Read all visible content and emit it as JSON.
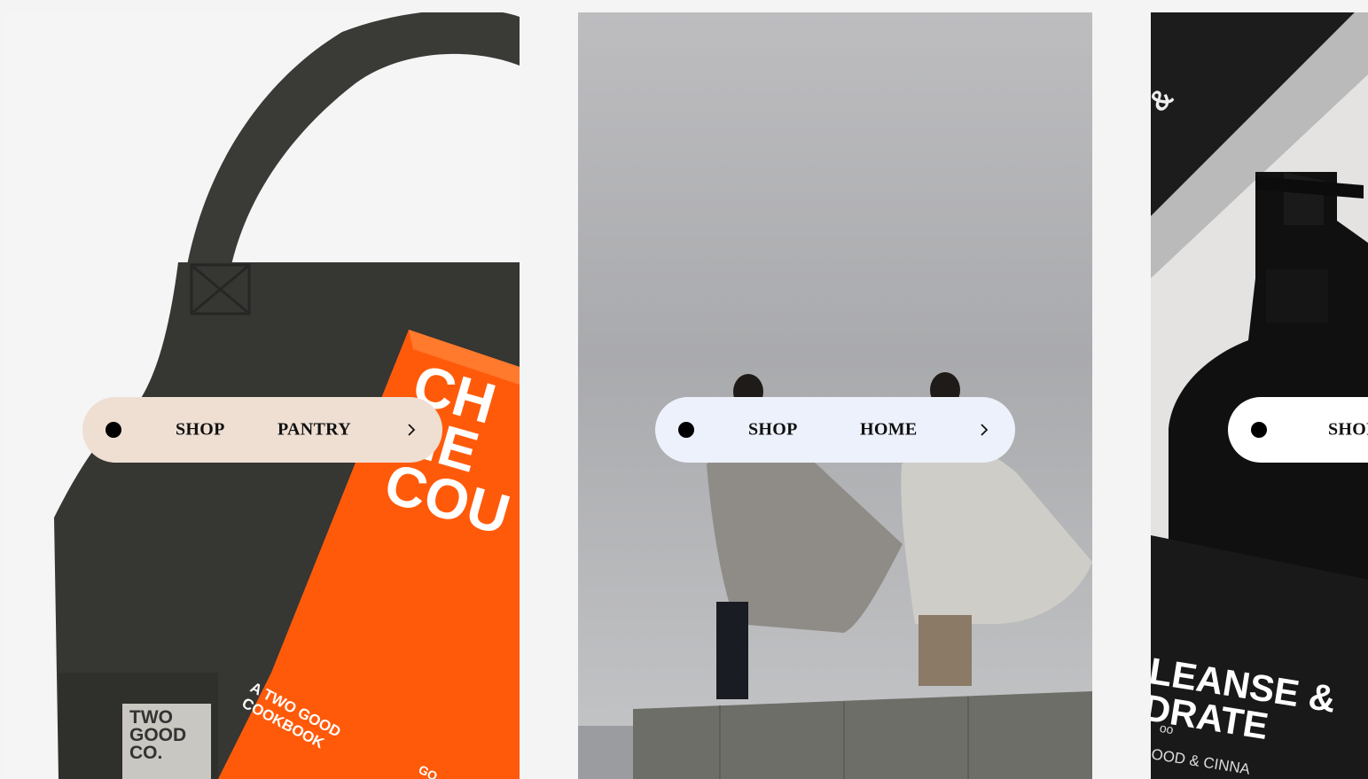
{
  "brand": {
    "logo_icon": "two-good-co-logo"
  },
  "cards": [
    {
      "pill": {
        "color": "#efdfd3",
        "label1": "SHOP",
        "label2": "PANTRY",
        "chevron_icon": "chevron-right-icon"
      },
      "photo_text": {
        "book_title": [
          "CH",
          "HE",
          "COU"
        ],
        "book_subtitle": [
          "A TWO GOOD",
          "COOKBOOK"
        ],
        "book_footer": "GO",
        "apron_tag": [
          "TWO",
          "GOOD",
          "CO."
        ]
      }
    },
    {
      "pill": {
        "color": "#edf1fb",
        "label1": "SHOP",
        "label2": "HOME",
        "chevron_icon": "chevron-right-icon"
      }
    },
    {
      "pill": {
        "color": "#ffffff",
        "label1": "SHOP"
      },
      "photo_text": {
        "bottle_lines": [
          "LEANSE &",
          "DRATE"
        ],
        "bottle_small": "oo",
        "bottle_footer": "OOD & CINNA",
        "corner": "&"
      }
    }
  ]
}
